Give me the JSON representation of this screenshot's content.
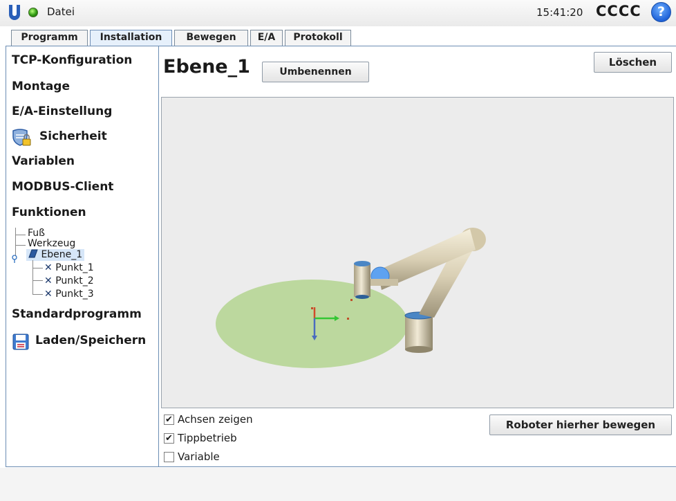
{
  "header": {
    "file_label": "Datei",
    "clock": "15:41:20",
    "robot_name": "CCCC",
    "help_symbol": "?",
    "status_color": "#2f9a12"
  },
  "tabs": [
    {
      "label": "Programm",
      "active": false
    },
    {
      "label": "Installation",
      "active": true
    },
    {
      "label": "Bewegen",
      "active": false
    },
    {
      "label": "E/A",
      "active": false
    },
    {
      "label": "Protokoll",
      "active": false
    }
  ],
  "sidebar": {
    "items": [
      {
        "label": "TCP-Konfiguration"
      },
      {
        "label": "Montage"
      },
      {
        "label": "E/A-Einstellung"
      },
      {
        "label": "Sicherheit",
        "icon": "shield-lock-icon"
      },
      {
        "label": "Variablen"
      },
      {
        "label": "MODBUS-Client"
      },
      {
        "label": "Funktionen"
      },
      {
        "label": "Standardprogramm"
      },
      {
        "label": "Laden/Speichern",
        "icon": "floppy-disk-icon"
      }
    ],
    "tree": [
      {
        "label": "Fuß"
      },
      {
        "label": "Werkzeug"
      },
      {
        "label": "Ebene_1",
        "selected": true,
        "icon": "plane-icon"
      },
      {
        "label": "Punkt_1",
        "icon": "point-x-icon"
      },
      {
        "label": "Punkt_2",
        "icon": "point-x-icon"
      },
      {
        "label": "Punkt_3",
        "icon": "point-x-icon"
      }
    ]
  },
  "main": {
    "feature_title": "Ebene_1",
    "rename_label": "Umbenennen",
    "delete_label": "Löschen",
    "move_robot_label": "Roboter hierher bewegen",
    "checkboxes": [
      {
        "label": "Achsen zeigen",
        "checked": true
      },
      {
        "label": "Tippbetrieb",
        "checked": true
      },
      {
        "label": "Variable",
        "checked": false
      }
    ]
  },
  "colors": {
    "accent": "#6b8db3",
    "plane": "#bcd89e",
    "robot_body": "#d9cfb4"
  }
}
